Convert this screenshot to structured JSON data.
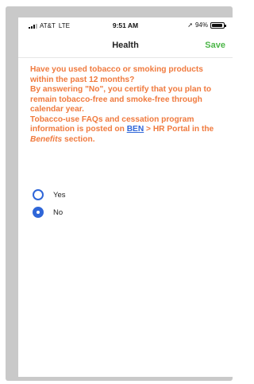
{
  "status_bar": {
    "carrier": "AT&T",
    "network": "LTE",
    "time": "9:51 AM",
    "battery_percent_text": "94%",
    "battery_level": 0.94,
    "location_icon": "location-arrow-icon"
  },
  "nav": {
    "title": "Health",
    "save_label": "Save"
  },
  "question": {
    "line1": "Have you used tobacco or smoking products within the past 12 months?",
    "line2": "By answering \"No\", you certify that you plan to remain tobacco-free and smoke-free through calendar year.",
    "line3_prefix": "Tobacco-use FAQs and cessation program information is posted on ",
    "link_text": "BEN",
    "line3_middle": " > HR Portal in the ",
    "italic_text": "Benefits",
    "line3_suffix": " section."
  },
  "options": [
    {
      "label": "Yes",
      "selected": false
    },
    {
      "label": "No",
      "selected": true
    }
  ],
  "colors": {
    "accent_orange": "#f07a3e",
    "save_green": "#4cb648",
    "radio_blue": "#2f66d8",
    "frame_gray": "#c9c9c9"
  }
}
